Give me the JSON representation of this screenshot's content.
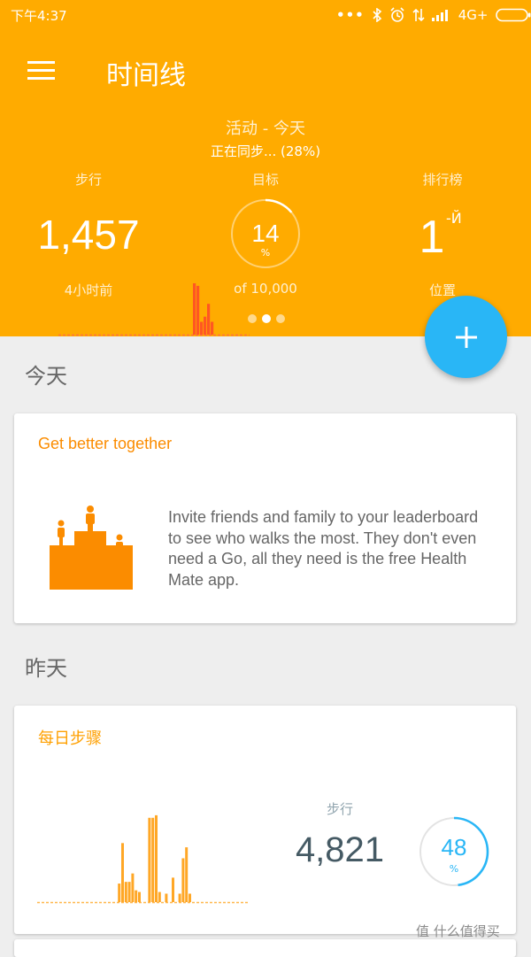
{
  "status_bar": {
    "time": "下午4:37",
    "network": "4G+",
    "icons": [
      "more-dots-icon",
      "bluetooth-icon",
      "alarm-icon",
      "data-arrows-icon",
      "signal-icon",
      "battery-icon"
    ]
  },
  "app_bar": {
    "title": "时间线",
    "menu_icon": "hamburger-menu-icon"
  },
  "summary": {
    "heading": "活动 - 今天",
    "sync_status": "正在同步... (28%)",
    "steps": {
      "label": "步行",
      "value": "1,457",
      "sub": "4小时前"
    },
    "goal": {
      "label": "目标",
      "percent": "14",
      "unit": "%",
      "sub": "of 10,000",
      "progress": 0.14
    },
    "leaderboard": {
      "label": "排行榜",
      "value": "1",
      "suffix": "-Й",
      "sub": "位置"
    },
    "page_indicator": {
      "count": 3,
      "active": 1
    }
  },
  "fab": {
    "icon": "plus-icon"
  },
  "today": {
    "section_label": "今天",
    "card": {
      "title": "Get better together",
      "body": "Invite friends and family to your leaderboard to see who walks the most. They don't even need a Go, all they need is the free Health Mate app.",
      "illustration": "podium-icon"
    }
  },
  "yesterday": {
    "section_label": "昨天",
    "card": {
      "title": "每日步骤",
      "steps_label": "步行",
      "steps_value": "4,821",
      "percent": "48",
      "unit": "%",
      "progress": 0.48
    }
  },
  "watermark": "值 什么值得买",
  "colors": {
    "header": "#ffab00",
    "bar_orange": "#ff5722",
    "bar_yellow": "#ffa726",
    "accent_blue": "#29b6f6",
    "title_orange": "#fb8c00"
  },
  "chart_data": [
    {
      "type": "bar",
      "name": "header-hourly-steps",
      "values": [
        0,
        0,
        0,
        0,
        0,
        0,
        0,
        0,
        0,
        0,
        0,
        0,
        0,
        0,
        0,
        0,
        0,
        0,
        0,
        0,
        0,
        0,
        0,
        0,
        0,
        0,
        0,
        0,
        0,
        0,
        0,
        0,
        0,
        0,
        0,
        0,
        0,
        0,
        1,
        0.95,
        0.25,
        0.35,
        0.6,
        0.25,
        0,
        0,
        0,
        0,
        0,
        0,
        0,
        0,
        0,
        0
      ],
      "ylim": [
        0,
        1
      ]
    },
    {
      "type": "bar",
      "name": "yesterday-daily-steps",
      "values": [
        0,
        0,
        0,
        0,
        0,
        0,
        0,
        0,
        0,
        0,
        0,
        0,
        0,
        0,
        0,
        0,
        0,
        0,
        0,
        0,
        0,
        0,
        0,
        0,
        0.22,
        0.7,
        0.24,
        0.24,
        0.34,
        0.14,
        0.12,
        0,
        0,
        1,
        1,
        1.03,
        0.12,
        0,
        0.1,
        0,
        0.29,
        0,
        0.1,
        0.52,
        0.65,
        0.1,
        0,
        0,
        0,
        0,
        0,
        0,
        0,
        0,
        0,
        0,
        0,
        0,
        0,
        0,
        0,
        0,
        0
      ],
      "ylim": [
        0,
        1.05
      ]
    }
  ]
}
